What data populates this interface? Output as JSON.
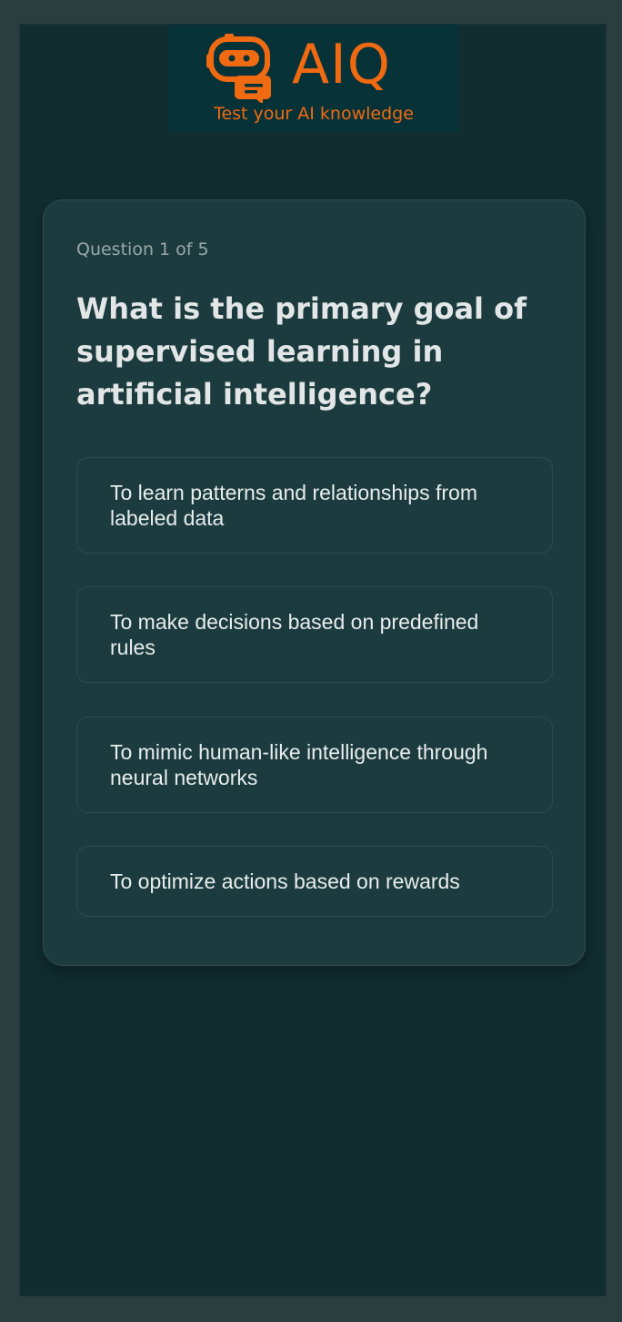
{
  "brand": {
    "name": "AIQ",
    "tagline": "Test your AI knowledge",
    "accent_color": "#f06a12"
  },
  "quiz": {
    "counter": "Question 1 of 5",
    "question": "What is the primary goal of supervised learning in artificial intelligence?",
    "options": [
      {
        "label": "To learn patterns and relationships from labeled data"
      },
      {
        "label": "To make decisions based on predefined rules"
      },
      {
        "label": "To mimic human-like intelligence through neural networks"
      },
      {
        "label": "To optimize actions based on rewards"
      }
    ]
  },
  "colors": {
    "page_background": "#2a3e40",
    "app_background": "#112d30",
    "card_background": "#1c3b3e"
  }
}
